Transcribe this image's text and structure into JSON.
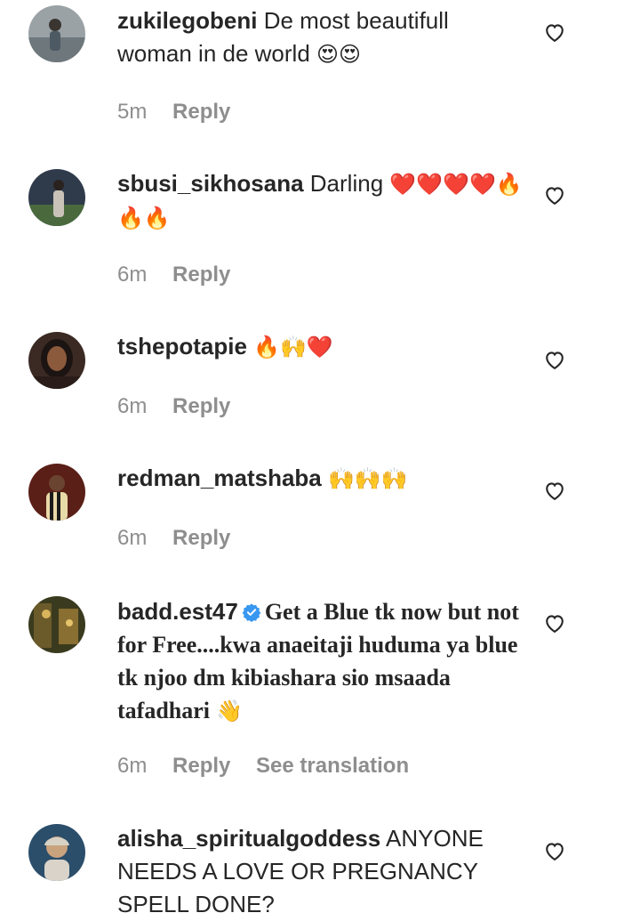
{
  "comments": [
    {
      "username": "zukilegobeni",
      "text": "De most beautifull woman in de world",
      "emoji": "😍😍",
      "time": "5m",
      "reply_label": "Reply"
    },
    {
      "username": "sbusi_sikhosana",
      "text": "Darling",
      "emoji": "❤️❤️❤️❤️🔥🔥🔥",
      "time": "6m",
      "reply_label": "Reply"
    },
    {
      "username": "tshepotapie",
      "text": "",
      "emoji": "🔥🙌❤️",
      "time": "6m",
      "reply_label": "Reply"
    },
    {
      "username": "redman_matshaba",
      "text": "",
      "emoji": "🙌🙌🙌",
      "time": "6m",
      "reply_label": "Reply"
    },
    {
      "username": "badd.est47",
      "verified": true,
      "text": "Get a Blue tk now but not for Free....kwa anaeitaji huduma ya blue tk njoo dm kibiashara sio msaada tafadhari",
      "emoji": "👋",
      "time": "6m",
      "reply_label": "Reply",
      "translate_label": "See translation"
    },
    {
      "username": "alisha_spiritualgoddess",
      "text": "ANYONE NEEDS A LOVE OR PREGNANCY SPELL DONE?",
      "emoji": "",
      "time": "",
      "reply_label": ""
    }
  ],
  "icons": {
    "like": "heart-outline-icon",
    "verified": "verified-badge-icon"
  },
  "colors": {
    "text": "#262626",
    "meta": "#8e8e8e",
    "verified": "#3897f0"
  }
}
